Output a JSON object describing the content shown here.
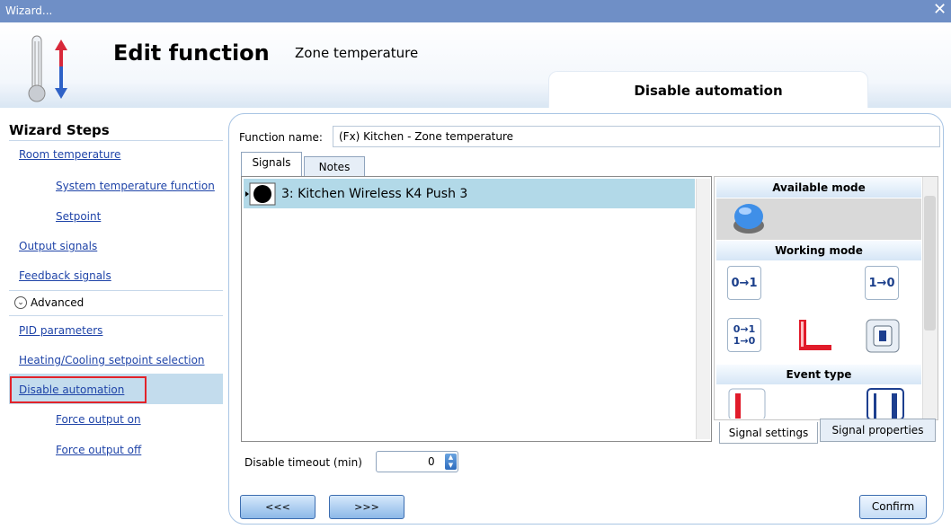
{
  "window": {
    "title": "Wizard...",
    "close_glyph": "✕"
  },
  "header": {
    "title": "Edit function",
    "function_type": "Zone temperature",
    "current_step": "Disable automation",
    "icon": "thermometer-icon"
  },
  "sidebar": {
    "heading": "Wizard Steps",
    "items": [
      {
        "label": "Room temperature"
      },
      {
        "label": "System temperature function"
      },
      {
        "label": "Setpoint"
      },
      {
        "label": "Output signals"
      },
      {
        "label": "Feedback signals"
      },
      {
        "label": "Advanced"
      },
      {
        "label": "PID parameters"
      },
      {
        "label": "Heating/Cooling setpoint selection"
      },
      {
        "label": "Disable automation"
      },
      {
        "label": "Force output on"
      },
      {
        "label": "Force output off"
      }
    ]
  },
  "main": {
    "function_name_label": "Function name:",
    "function_name_value": "(Fx) Kitchen - Zone temperature",
    "tabs": [
      {
        "label": "Signals"
      },
      {
        "label": "Notes"
      }
    ],
    "signals": [
      {
        "label": "3: Kitchen Wireless K4 Push 3"
      }
    ],
    "right_panel": {
      "available_mode": "Available mode",
      "working_mode": "Working mode",
      "event_type": "Event type",
      "working_icons": [
        "0→1",
        "1→0",
        "0→1\n1→0"
      ]
    },
    "subtabs": [
      {
        "label": "Signal settings"
      },
      {
        "label": "Signal properties"
      }
    ],
    "timeout_label": "Disable timeout (min)",
    "timeout_value": "0"
  },
  "footer": {
    "prev_label": "<<<",
    "next_label": ">>>",
    "confirm_label": "Confirm"
  },
  "colors": {
    "titlebar": "#6f8fc6",
    "link": "#1f44a8",
    "selected_row": "#b2d9e8",
    "highlight_box": "#e2232a"
  }
}
